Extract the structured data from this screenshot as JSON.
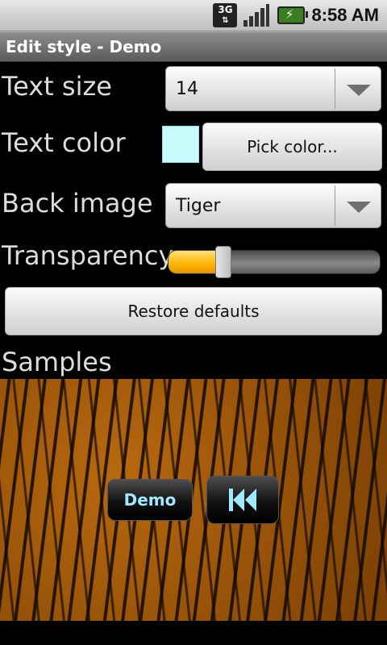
{
  "status_bar": {
    "network": "3G",
    "time": "8:58 AM",
    "icons": [
      "network-3g-icon",
      "signal-icon",
      "battery-charging-icon"
    ]
  },
  "title_bar": {
    "title": "Edit style - Demo"
  },
  "form": {
    "text_size": {
      "label": "Text size",
      "value": "14"
    },
    "text_color": {
      "label": "Text color",
      "swatch_color": "#c6fbfb",
      "button_label": "Pick color..."
    },
    "back_image": {
      "label": "Back image",
      "value": "Tiger"
    },
    "transparency": {
      "label": "Transparency",
      "level_percent": 26
    },
    "restore_label": "Restore defaults"
  },
  "samples": {
    "label": "Samples",
    "demo_button": "Demo",
    "rewind_icon": "rewind-icon"
  },
  "colors": {
    "accent": "#ffb400",
    "sample_text": "#9fe9ff"
  }
}
